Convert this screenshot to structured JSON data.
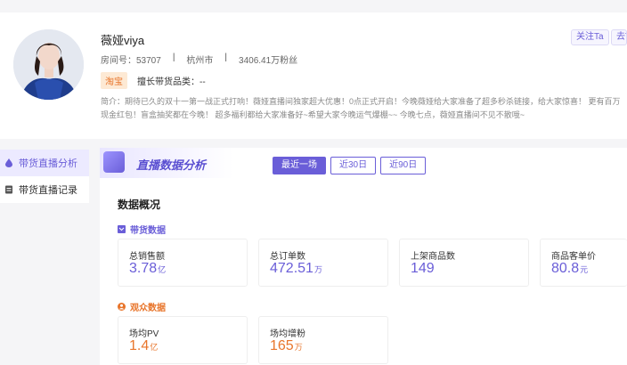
{
  "streamer": {
    "name": "薇娅viya",
    "room_label": "房间号：53707",
    "city": "杭州市",
    "fans": "3406.41万粉丝",
    "platform_tag": "淘宝",
    "category_label": "擅长带货品类：--",
    "intro_line1": "简介：期待已久的双十一第一战正式打响！薇娅直播间独家超大优惠！0点正式开启！今晚薇娅给大家准备了超多秒杀链接，给大家惊喜！ 更有百万",
    "intro_line2": "现金红包！盲盒抽奖都在今晚！ 超多福利都给大家准备好~希望大家今晚运气爆棚~~ 今晚七点，薇娅直播间不见不散哦~",
    "separator": "|"
  },
  "actions": {
    "follow": "关注Ta",
    "goto": "去T"
  },
  "sidebar": {
    "items": [
      {
        "label": "带货直播分析"
      },
      {
        "label": "带货直播记录"
      }
    ]
  },
  "main": {
    "banner_title": "直播数据分析",
    "periods": [
      "最近一场",
      "近30日",
      "近90日"
    ],
    "overview_title": "数据概况",
    "sales_section": "带货数据",
    "audience_section": "观众数据",
    "sales_cards": [
      {
        "label": "总销售额",
        "value": "3.78",
        "unit": "亿"
      },
      {
        "label": "总订单数",
        "value": "472.51",
        "unit": "万"
      },
      {
        "label": "上架商品数",
        "value": "149",
        "unit": ""
      },
      {
        "label": "商品客单价",
        "value": "80.8",
        "unit": "元"
      }
    ],
    "audience_cards": [
      {
        "label": "场均PV",
        "value": "1.4",
        "unit": "亿"
      },
      {
        "label": "场均增粉",
        "value": "165",
        "unit": "万"
      }
    ]
  },
  "colors": {
    "accent": "#6a5ed8",
    "orange": "#e8752b",
    "tag_bg": "#fde9d4"
  },
  "icons": [
    "avatar",
    "droplet-icon",
    "record-icon",
    "bag-icon",
    "person-icon",
    "chart-logo-icon"
  ]
}
